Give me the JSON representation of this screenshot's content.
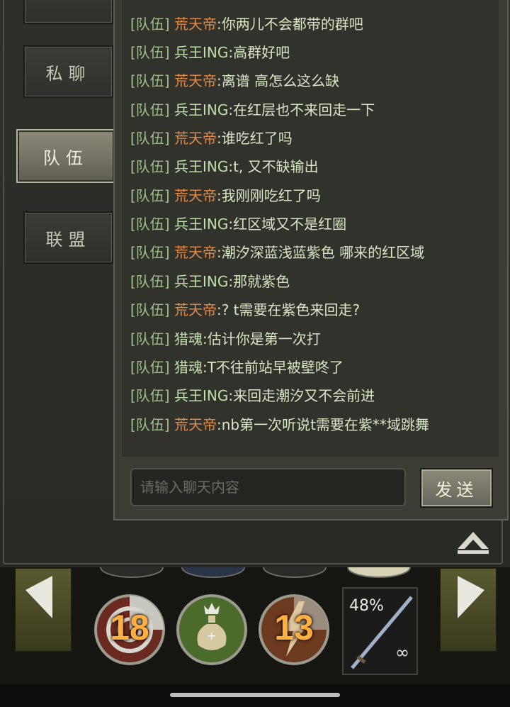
{
  "tabs": [
    {
      "label": "私聊"
    },
    {
      "label": "队伍"
    },
    {
      "label": "联盟"
    }
  ],
  "chat": {
    "messages": [
      {
        "channel": "[队伍]",
        "sender": "荒天帝",
        "text": ":你两儿不会都带的群吧"
      },
      {
        "channel": "[队伍]",
        "sender": "兵王ING",
        "text": ":高群好吧"
      },
      {
        "channel": "[队伍]",
        "sender": "荒天帝",
        "text": ":离谱 高怎么这么缺"
      },
      {
        "channel": "[队伍]",
        "sender": "兵王ING",
        "text": ":在红层也不来回走一下"
      },
      {
        "channel": "[队伍]",
        "sender": "荒天帝",
        "text": ":谁吃红了吗"
      },
      {
        "channel": "[队伍]",
        "sender": "兵王ING",
        "text": ":t, 又不缺输出"
      },
      {
        "channel": "[队伍]",
        "sender": "荒天帝",
        "text": ":我刚刚吃红了吗"
      },
      {
        "channel": "[队伍]",
        "sender": "兵王ING",
        "text": ":红区域又不是红圈"
      },
      {
        "channel": "[队伍]",
        "sender": "荒天帝",
        "text": ":潮汐深蓝浅蓝紫色 哪来的红区域"
      },
      {
        "channel": "[队伍]",
        "sender": "兵王ING",
        "text": ":那就紫色"
      },
      {
        "channel": "[队伍]",
        "sender": "荒天帝",
        "text": ":? t需要在紫色来回走?"
      },
      {
        "channel": "[队伍]",
        "sender": "猎魂",
        "text": ":估计你是第一次打"
      },
      {
        "channel": "[队伍]",
        "sender": "猎魂",
        "text": ":T不往前站早被壁咚了"
      },
      {
        "channel": "[队伍]",
        "sender": "兵王ING",
        "text": ":来回走潮汐又不会前进"
      },
      {
        "channel": "[队伍]",
        "sender": "荒天帝",
        "text": ":nb第一次听说t需要在紫**域跳舞"
      }
    ],
    "input_placeholder": "请输入聊天内容",
    "send_label": "发送"
  },
  "hud": {
    "skills": [
      {
        "icon": "bullseye-skill-icon",
        "count": "18"
      },
      {
        "icon": "heal-potion-skill-icon",
        "count": ""
      },
      {
        "icon": "lightning-skill-icon",
        "count": "13"
      }
    ],
    "weapon": {
      "durability": "48%",
      "ammo": "∞"
    }
  },
  "colors": {
    "channel": "#9fc08a",
    "sender_a": "#e08a4a",
    "sender_b": "#bfe0a8",
    "message": "#d9e6c4"
  }
}
